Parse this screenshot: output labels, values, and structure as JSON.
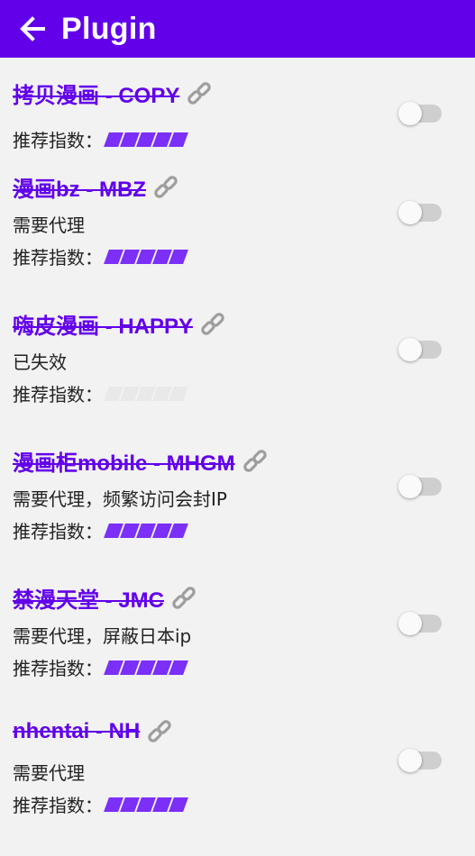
{
  "appbar": {
    "title": "Plugin"
  },
  "rating_label": "推荐指数：",
  "plugins": [
    {
      "name": "拷贝漫画 - COPY",
      "desc": "",
      "rating": 5,
      "enabled": false
    },
    {
      "name": "漫画bz - MBZ",
      "desc": "需要代理",
      "rating": 5,
      "enabled": false
    },
    {
      "name": "嗨皮漫画 - HAPPY",
      "desc": "已失效",
      "rating": 0,
      "enabled": false
    },
    {
      "name": "漫画柜mobile - MHGM",
      "desc": "需要代理，频繁访问会封IP",
      "rating": 5,
      "enabled": false
    },
    {
      "name": "禁漫天堂 - JMC",
      "desc": "需要代理，屏蔽日本ip",
      "rating": 5,
      "enabled": false
    },
    {
      "name": "nhentai - NH",
      "desc": "需要代理",
      "rating": 5,
      "enabled": false
    }
  ],
  "colors": {
    "primary": "#6200ea",
    "rating_on": "#7b2ff7",
    "rating_off": "#e9e9e9"
  }
}
